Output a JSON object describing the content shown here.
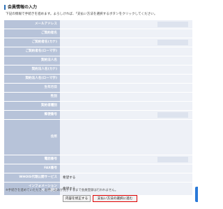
{
  "header": {
    "title": "会員情報の入力",
    "intro": "下記の情報で手続きを進めます。よろしければ、「支払い方法を選択するボタンをクリックしてください。"
  },
  "form": {
    "rows": [
      {
        "label": "メールアドレス",
        "value": ""
      },
      {
        "label": "ご契約者名",
        "value": ""
      },
      {
        "label": "ご契約者名(カナ)",
        "value": ""
      },
      {
        "label": "ご契約者名(ローマ字)",
        "value": ""
      },
      {
        "label": "契約法人名",
        "value": ""
      },
      {
        "label": "契約法人名(カナ)",
        "value": ""
      },
      {
        "label": "契約法人名(ローマ字)",
        "value": ""
      },
      {
        "label": "生年月日",
        "value": ""
      },
      {
        "label": "性別",
        "value": ""
      },
      {
        "label": "契約者種別",
        "value": ""
      },
      {
        "label": "郵便番号",
        "value": ""
      },
      {
        "label": "住所",
        "value": ""
      },
      {
        "label": "電話番号",
        "value": ""
      },
      {
        "label": "FAX番号",
        "value": ""
      },
      {
        "label": "WHOIS代理公開サービス",
        "value": "希望する"
      },
      {
        "label": "インフォメーション\nメール配信",
        "value": "希望する"
      }
    ]
  },
  "footer": {
    "note": "※手続きを進めていただき、お申し込みが完了するまで会員登録は行われません。",
    "edit_button": "内容を修正する",
    "next_button": "支払い方法の選択に進む"
  }
}
